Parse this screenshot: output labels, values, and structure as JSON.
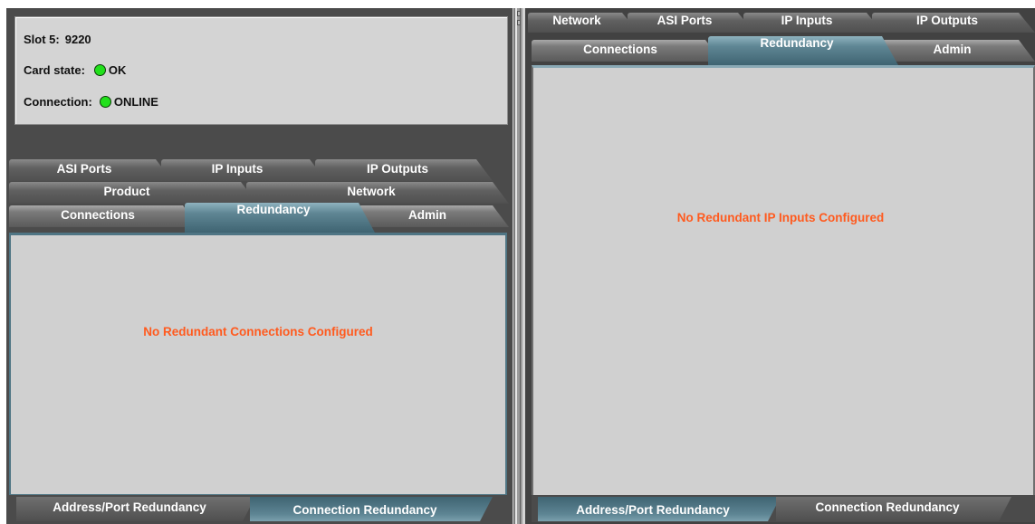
{
  "left": {
    "info": {
      "slot_label": "Slot 5:",
      "slot_value": "9220",
      "card_state_label": "Card state:",
      "card_state_value": "OK",
      "connection_label": "Connection:",
      "connection_value": "ONLINE",
      "status_color": "#22e01c"
    },
    "tabs": {
      "row1": [
        "ASI Ports",
        "IP Inputs",
        "IP Outputs"
      ],
      "row2": [
        "Product",
        "Network"
      ],
      "row3": [
        "Connections",
        "Redundancy",
        "Admin"
      ],
      "selected": "Redundancy"
    },
    "message": "No Redundant Connections Configured",
    "bottom_tabs": [
      "Address/Port Redundancy",
      "Connection Redundancy"
    ],
    "bottom_selected": "Connection Redundancy"
  },
  "right": {
    "tabs": {
      "row1": [
        "Network",
        "ASI Ports",
        "IP Inputs",
        "IP Outputs"
      ],
      "row2": [
        "Connections",
        "Redundancy",
        "Admin"
      ],
      "selected": "Redundancy"
    },
    "message": "No Redundant IP Inputs Configured",
    "bottom_tabs": [
      "Address/Port Redundancy",
      "Connection Redundancy"
    ],
    "bottom_selected": "Address/Port Redundancy"
  },
  "colors": {
    "accent": "#5f8694",
    "message": "#ff5a1e",
    "panel": "#d0d0d0"
  }
}
